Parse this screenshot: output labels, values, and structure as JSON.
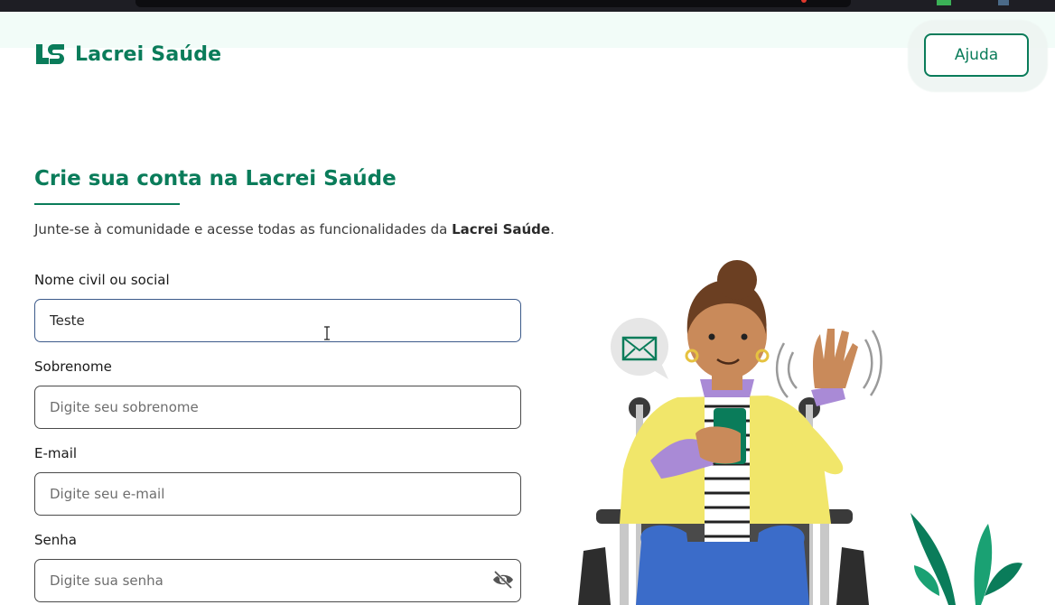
{
  "brand": {
    "name": "Lacrei Saúde",
    "color": "#0a7c5a"
  },
  "header": {
    "help_label": "Ajuda"
  },
  "form": {
    "title": "Crie sua conta na Lacrei Saúde",
    "subtitle_prefix": "Junte-se à comunidade e acesse todas as funcionalidades da ",
    "subtitle_brand": "Lacrei Saúde",
    "subtitle_suffix": ".",
    "fields": {
      "name": {
        "label": "Nome civil ou social",
        "value": "Teste",
        "placeholder": ""
      },
      "surname": {
        "label": "Sobrenome",
        "value": "",
        "placeholder": "Digite seu sobrenome"
      },
      "email": {
        "label": "E-mail",
        "value": "",
        "placeholder": "Digite seu e-mail"
      },
      "password": {
        "label": "Senha",
        "value": "",
        "placeholder": "Digite sua senha"
      }
    }
  },
  "icons": {
    "logo": "ls-logo-icon",
    "eye": "eye-off-icon",
    "cursor": "text-cursor-icon",
    "envelope": "envelope-icon"
  }
}
